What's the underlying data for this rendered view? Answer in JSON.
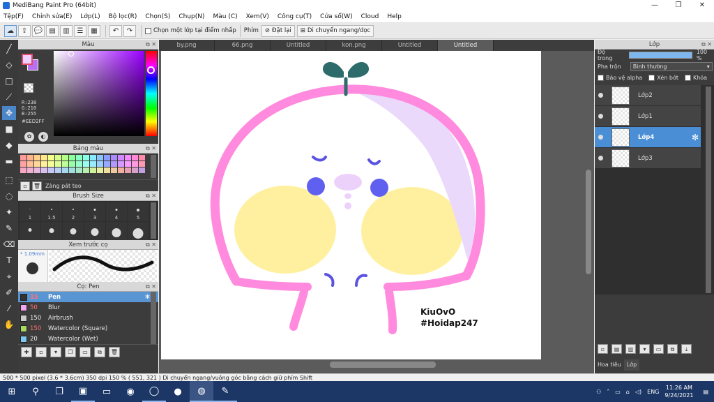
{
  "window": {
    "title": "MediBang Paint Pro (64bit)",
    "minimize": "—",
    "maximize": "❐",
    "close": "✕"
  },
  "menu": [
    "Tệp(F)",
    "Chỉnh sửa(E)",
    "Lớp(L)",
    "Bộ lọc(R)",
    "Chọn(S)",
    "Chụp(N)",
    "Màu (C)",
    "Xem(V)",
    "Công cụ(T)",
    "Cửa sổ(W)",
    "Cloud",
    "Help"
  ],
  "toolbar": {
    "select_layer_label": "Chọn một lớp tại điểm nhấp",
    "key_label": "Phím",
    "reset_label": "Đặt lại",
    "move_label": "Di chuyển ngang/dọc"
  },
  "panels": {
    "color": {
      "title": "Màu",
      "r": "R:238",
      "g": "G:210",
      "b": "B:255",
      "hex": "#EED2FF",
      "fg_color": "#EED2FF"
    },
    "palette": {
      "title": "Bảng màu",
      "footer_label": "Zàng pát teo",
      "colors": [
        "#ff9a9a",
        "#ffb38a",
        "#ffd08a",
        "#ffe98a",
        "#f3ff8a",
        "#d6ff8a",
        "#b6ff8a",
        "#8aff9a",
        "#8affc1",
        "#8affe8",
        "#8ae9ff",
        "#8ac4ff",
        "#8a9cff",
        "#a98aff",
        "#cf8aff",
        "#f58aff",
        "#ff8ad8",
        "#ff8aa9",
        "#ffa3a3",
        "#ffbf99",
        "#ffd799",
        "#ffef99",
        "#f5ff99",
        "#dcff99",
        "#bfff99",
        "#99ffa6",
        "#99ffcc",
        "#99fff0",
        "#99ecff",
        "#99cfff",
        "#99a9ff",
        "#b399ff",
        "#d699ff",
        "#fa99ff",
        "#ff99df",
        "#ff99b3",
        "#f7a7c2",
        "#f0b0d0",
        "#e8b8e0",
        "#d8c0f0",
        "#c8c8f8",
        "#b8d0f8",
        "#a8d8f0",
        "#a0e0e0",
        "#a8e8c8",
        "#b8f0b0",
        "#d0f0a0",
        "#e8f0a0",
        "#f0e0a0",
        "#f0c8a0",
        "#f0b0a0",
        "#e8a0b0",
        "#d8a0c8",
        "#c0a0e0"
      ]
    },
    "brush_size": {
      "title": "Brush Size",
      "values": [
        "1",
        "1.5",
        "2",
        "3",
        "4",
        "5"
      ]
    },
    "brush_preview": {
      "title": "Xem trước cọ",
      "size": "* 1.09mm"
    },
    "brush": {
      "title": "Cọ: Pen",
      "items": [
        {
          "size": "15",
          "name": "Pen",
          "color": "#333333"
        },
        {
          "size": "50",
          "name": "Blur",
          "color": "#f4a6f0"
        },
        {
          "size": "150",
          "name": "Airbrush",
          "color": "#cccccc"
        },
        {
          "size": "150",
          "name": "Watercolor (Square)",
          "color": "#a8d860"
        },
        {
          "size": "20",
          "name": "Watercolor (Wet)",
          "color": "#7ec8f0"
        }
      ]
    }
  },
  "tabs": [
    "by.png",
    "66.png",
    "Untitled",
    "kon.png",
    "Untitled",
    "Untitled"
  ],
  "canvas": {
    "signature_line1": "KiuOvO",
    "signature_line2": "#Hoidap247"
  },
  "layers_panel": {
    "title": "Lớp",
    "opacity_label": "Độ trong",
    "opacity_value": "100 %",
    "opacity_fraction": 1.0,
    "blend_label": "Pha trộn",
    "blend_value": "Bình thường",
    "alpha_protect": "Bảo vệ alpha",
    "clip": "Xén bớt",
    "lock": "Khóa",
    "layers": [
      {
        "name": "Lớp2",
        "selected": false
      },
      {
        "name": "Lớp1",
        "selected": false
      },
      {
        "name": "Lớp4",
        "selected": true
      },
      {
        "name": "Lớp3",
        "selected": false
      }
    ],
    "bottom_tabs": [
      "Hoa tiêu",
      "Lớp"
    ]
  },
  "status": "500 * 500 pixel   (3.6 * 3.6cm)   350 dpi   150 %   ( 551, 321 )   Di chuyển ngang/vuông góc bằng cách giữ phím Shift",
  "taskbar": {
    "lang": "ENG",
    "time": "11:26 AM",
    "date": "9/24/2021"
  },
  "colors": {
    "accent": "#4a8fd6",
    "panel_bg": "#3c3c3c",
    "head_pink": "#ff8ade",
    "cheek_yellow": "#fff0a0",
    "eye_blue": "#6060f0",
    "sprout": "#2e6b6b"
  }
}
